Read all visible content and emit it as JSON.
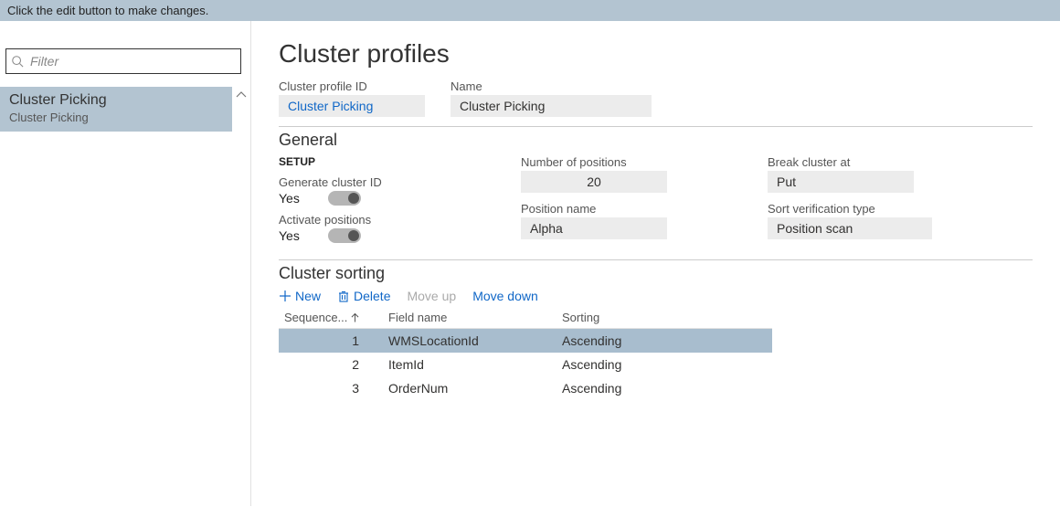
{
  "notification": "Click the edit button to make changes.",
  "filter": {
    "placeholder": "Filter"
  },
  "listItem": {
    "title": "Cluster Picking",
    "subtitle": "Cluster Picking"
  },
  "page": {
    "title": "Cluster profiles",
    "idLabel": "Cluster profile ID",
    "idValue": "Cluster Picking",
    "nameLabel": "Name",
    "nameValue": "Cluster Picking"
  },
  "general": {
    "header": "General",
    "setupHeading": "SETUP",
    "genIdLabel": "Generate cluster ID",
    "genIdValue": "Yes",
    "activateLabel": "Activate positions",
    "activateValue": "Yes",
    "numPosLabel": "Number of positions",
    "numPosValue": "20",
    "posNameLabel": "Position name",
    "posNameValue": "Alpha",
    "breakLabel": "Break cluster at",
    "breakValue": "Put",
    "sortVerLabel": "Sort verification type",
    "sortVerValue": "Position scan"
  },
  "sorting": {
    "header": "Cluster sorting",
    "actions": {
      "new": "New",
      "delete": "Delete",
      "moveUp": "Move up",
      "moveDown": "Move down"
    },
    "columns": {
      "seq": "Sequence...",
      "field": "Field name",
      "sort": "Sorting"
    },
    "rows": [
      {
        "seq": "1",
        "field": "WMSLocationId",
        "sort": "Ascending"
      },
      {
        "seq": "2",
        "field": "ItemId",
        "sort": "Ascending"
      },
      {
        "seq": "3",
        "field": "OrderNum",
        "sort": "Ascending"
      }
    ]
  }
}
